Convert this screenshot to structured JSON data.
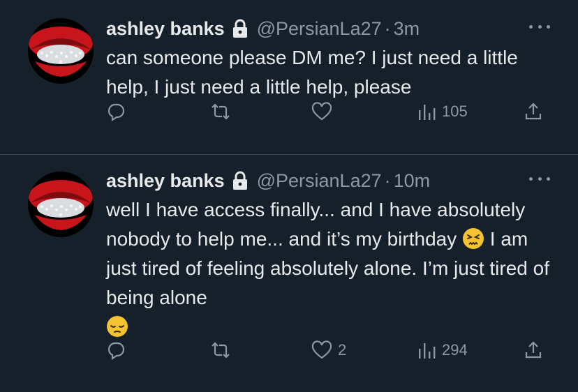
{
  "tweets": [
    {
      "user_name": "ashley banks",
      "handle": "@PersianLa27",
      "separator": "·",
      "time": "3m",
      "text": "can someone please DM me? I just need a little help, I just need a little help, please",
      "likes": "",
      "views": "105",
      "icons": [
        "lock-icon",
        "more-icon",
        "reply-icon",
        "retweet-icon",
        "like-icon",
        "views-icon",
        "share-icon"
      ]
    },
    {
      "user_name": "ashley banks",
      "handle": "@PersianLa27",
      "separator": "·",
      "time": "10m",
      "text_1": "well I have access finally... and I have absolutely nobody to help me... and it’s my birthday ",
      "text_2": " I am just tired of feeling absolutely alone. I’m just tired of being alone",
      "emoji_1": "persevering-face",
      "emoji_2": "pensive-face",
      "likes": "2",
      "views": "294",
      "icons": [
        "lock-icon",
        "more-icon",
        "reply-icon",
        "retweet-icon",
        "like-icon",
        "views-icon",
        "share-icon"
      ]
    }
  ],
  "colors": {
    "background": "#15202b",
    "divider": "#38444d",
    "primary_text": "#e7e9ea",
    "secondary_text": "#8b98a5",
    "avatar_lips": "#c8151b"
  }
}
